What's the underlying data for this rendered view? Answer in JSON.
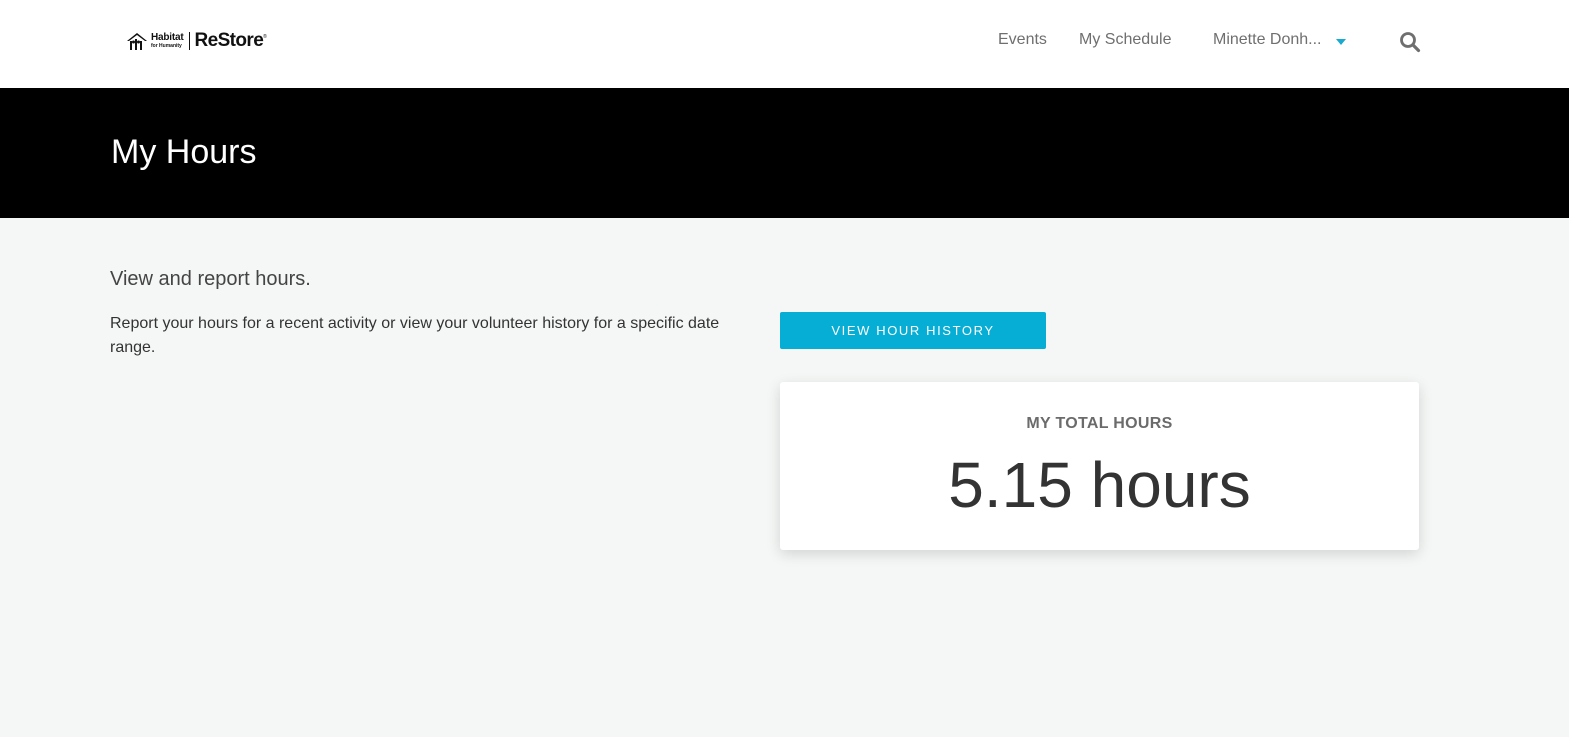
{
  "brand": {
    "logo_line1": "Habitat",
    "logo_line2": "for Humanity",
    "logo_product": "ReStore",
    "logo_tm": "®"
  },
  "nav": {
    "events_label": "Events",
    "schedule_label": "My Schedule",
    "user_name": "Minette Donh...",
    "search_icon": "search-icon",
    "caret_icon": "chevron-down-icon"
  },
  "banner": {
    "title": "My Hours"
  },
  "content": {
    "subheading": "View and report hours.",
    "intro": "Report your hours for a recent activity or view your volunteer history for a specific date range.",
    "history_button_label": "VIEW HOUR HISTORY"
  },
  "hours_card": {
    "label": "MY TOTAL HOURS",
    "value": "5.15 hours"
  },
  "colors": {
    "accent": "#06aed5",
    "banner_bg": "#000000",
    "page_bg": "#f5f7f6"
  }
}
